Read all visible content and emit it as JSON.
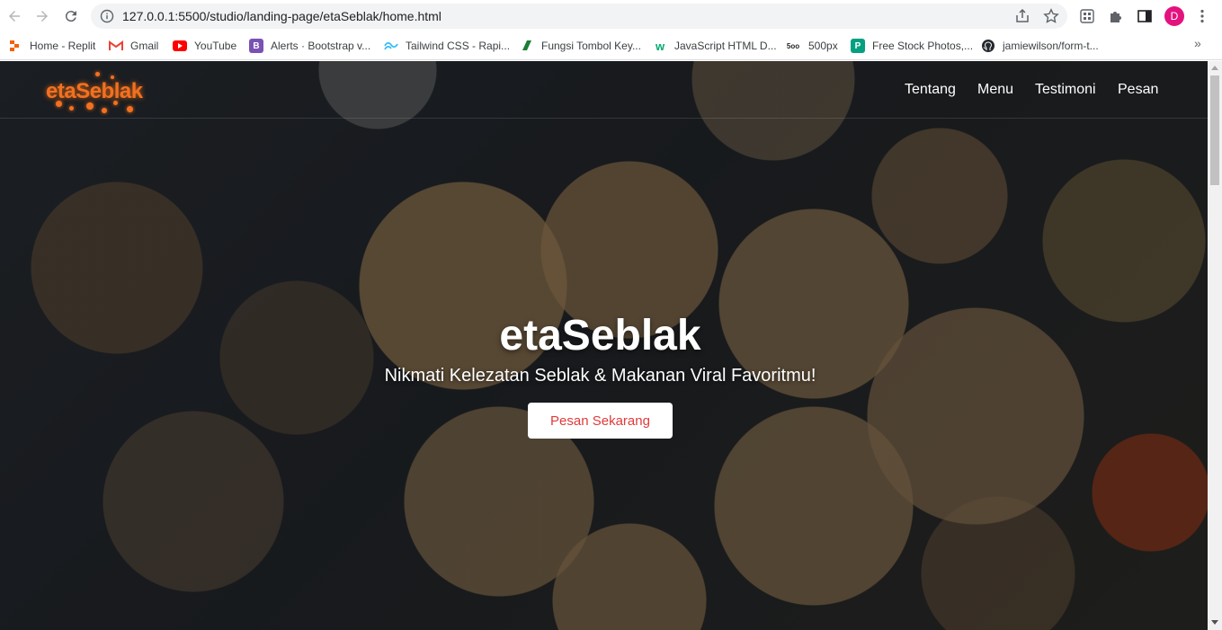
{
  "browser": {
    "url": "127.0.0.1:5500/studio/landing-page/etaSeblak/home.html",
    "profile_initial": "D",
    "bookmarks": [
      {
        "label": "Home - Replit",
        "icon": "replit-icon"
      },
      {
        "label": "Gmail",
        "icon": "gmail-icon"
      },
      {
        "label": "YouTube",
        "icon": "youtube-icon"
      },
      {
        "label": "Alerts · Bootstrap v...",
        "icon": "bootstrap-icon"
      },
      {
        "label": "Tailwind CSS - Rapi...",
        "icon": "tailwind-icon"
      },
      {
        "label": "Fungsi Tombol Key...",
        "icon": "keyboard-icon"
      },
      {
        "label": "JavaScript HTML D...",
        "icon": "w3schools-icon"
      },
      {
        "label": "500px",
        "icon": "500px-icon"
      },
      {
        "label": "Free Stock Photos,...",
        "icon": "pexels-icon"
      },
      {
        "label": "jamiewilson/form-t...",
        "icon": "github-icon"
      }
    ],
    "colors": {
      "avatar": "#e4127f",
      "youtube": "#ff0000",
      "bootstrap": "#7952b3"
    }
  },
  "site": {
    "brand": "etaSeblak",
    "nav": [
      "Tentang",
      "Menu",
      "Testimoni",
      "Pesan"
    ],
    "hero": {
      "title": "etaSeblak",
      "subtitle": "Nikmati Kelezatan Seblak & Makanan Viral Favoritmu!",
      "cta": "Pesan Sekarang"
    },
    "colors": {
      "brand": "#f37021",
      "cta_text": "#e03a3a"
    }
  }
}
